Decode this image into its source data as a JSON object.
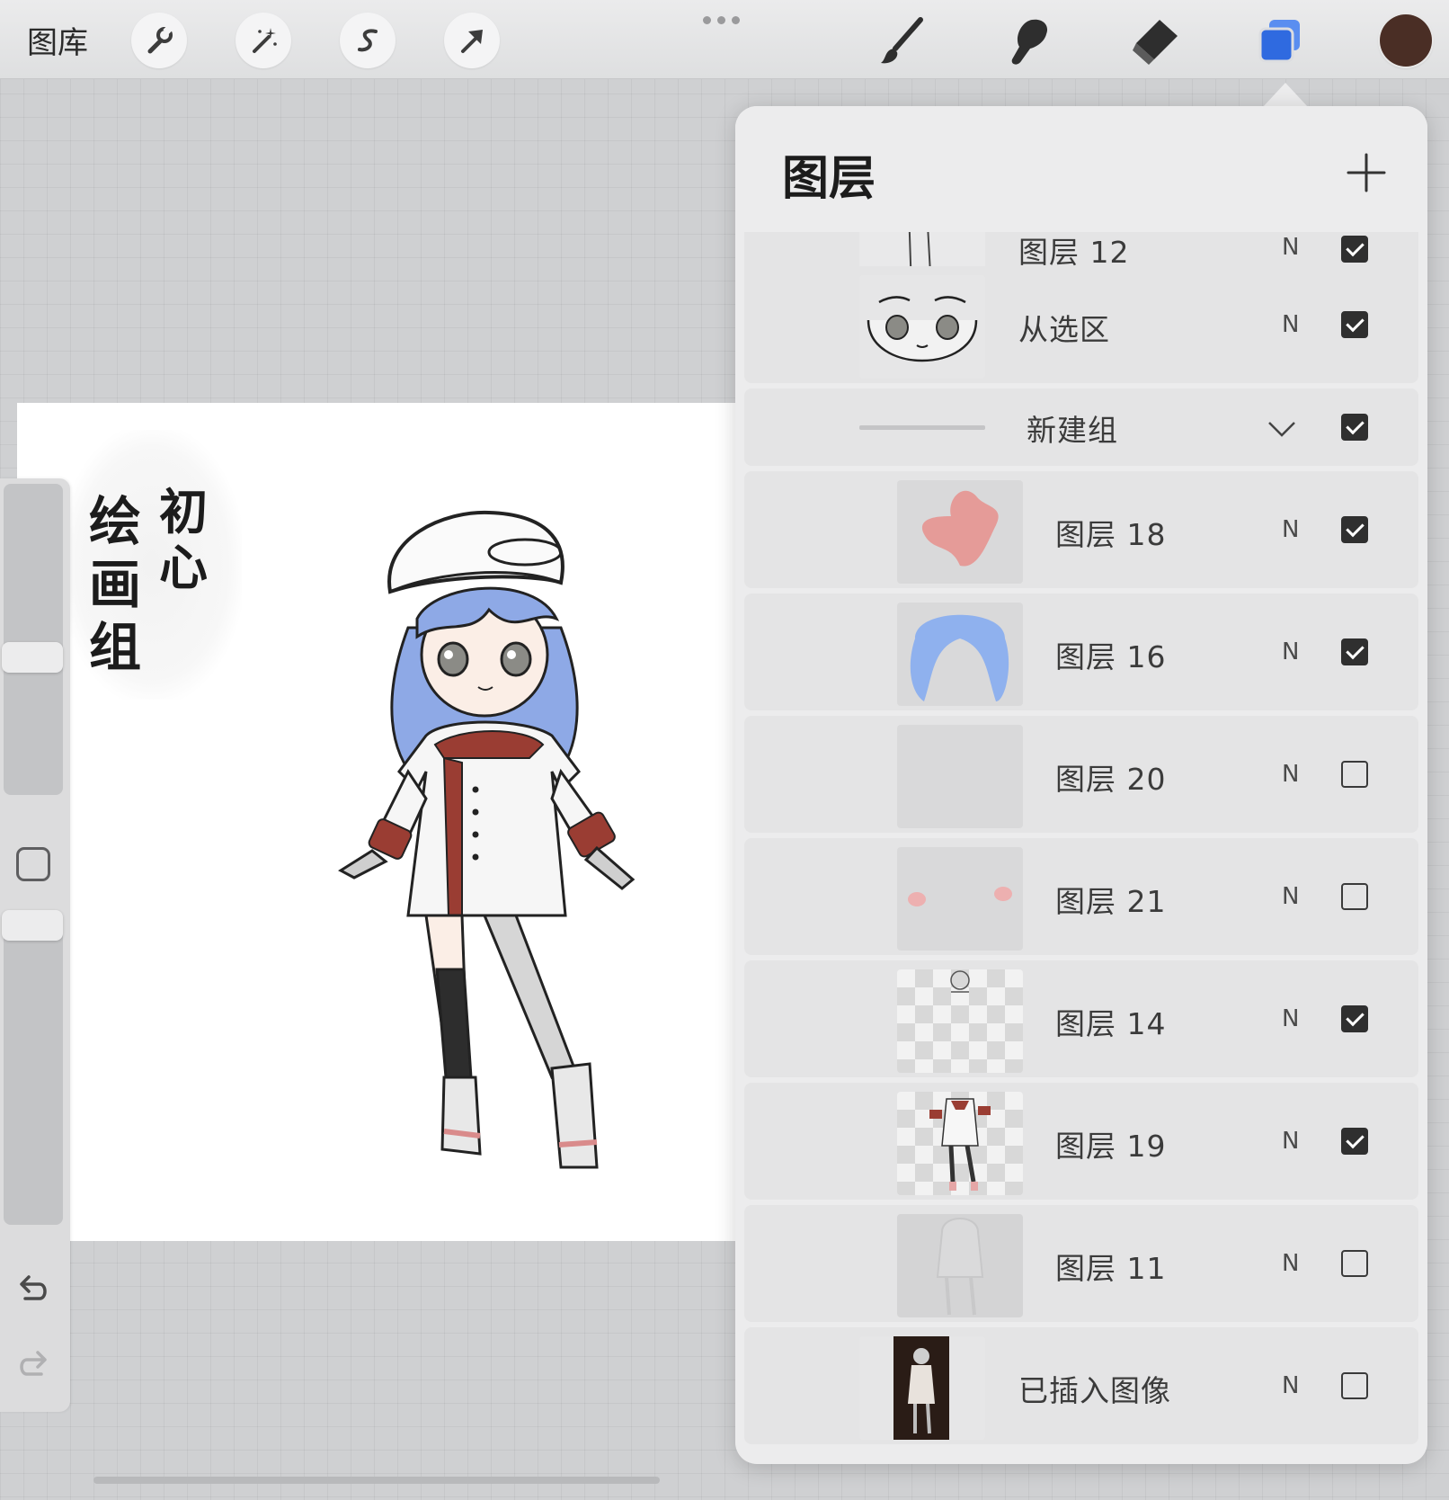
{
  "toolbar": {
    "gallery_label": "图库",
    "left_tools": [
      "wrench-icon",
      "magic-wand-icon",
      "selection-icon",
      "transform-arrow-icon"
    ],
    "right_tools": [
      "brush-icon",
      "smudge-icon",
      "eraser-icon",
      "layers-icon"
    ],
    "current_color": "#4a2e25",
    "layers_accent": "#2f6ae0"
  },
  "canvas": {
    "calligraphy_text": "绘画组初心"
  },
  "sidebar": {
    "brush_size_level": 0.5,
    "opacity_level": 0.95
  },
  "layers_panel": {
    "title": "图层",
    "add_icon": "plus-icon",
    "layers": [
      {
        "name": "图层 12",
        "blend": "N",
        "visible": true
      },
      {
        "name": "从选区",
        "blend": "N",
        "visible": true
      },
      {
        "name": "新建组",
        "blend": "",
        "visible": true,
        "group": true
      },
      {
        "name": "图层 18",
        "blend": "N",
        "visible": true
      },
      {
        "name": "图层 16",
        "blend": "N",
        "visible": true
      },
      {
        "name": "图层 20",
        "blend": "N",
        "visible": false
      },
      {
        "name": "图层 21",
        "blend": "N",
        "visible": false
      },
      {
        "name": "图层 14",
        "blend": "N",
        "visible": true
      },
      {
        "name": "图层 19",
        "blend": "N",
        "visible": true
      },
      {
        "name": "图层 11",
        "blend": "N",
        "visible": false
      },
      {
        "name": "已插入图像",
        "blend": "N",
        "visible": false
      }
    ]
  }
}
